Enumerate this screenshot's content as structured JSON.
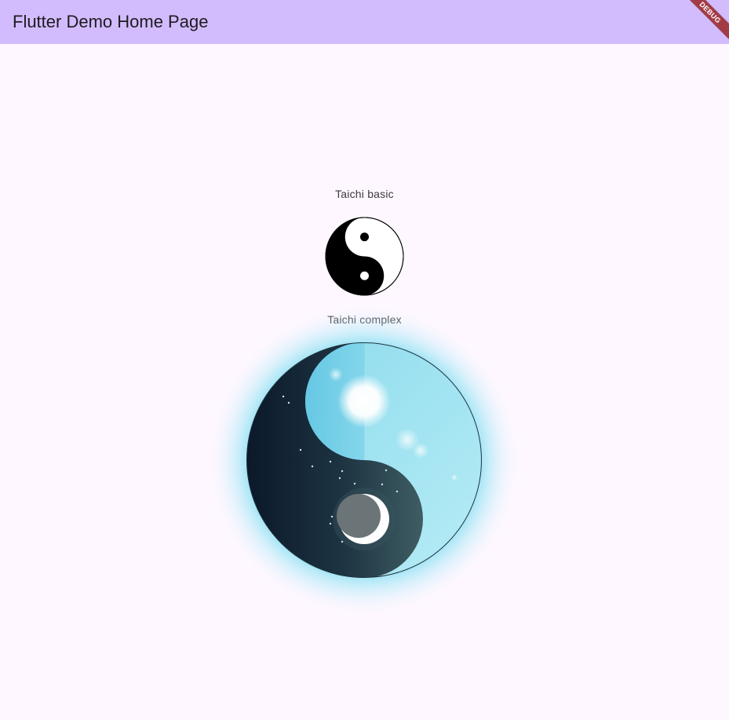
{
  "app_bar": {
    "title": "Flutter Demo Home Page",
    "background_color": "#d2bcfd",
    "debug_label": "DEBUG",
    "debug_color": "#a23b45"
  },
  "page": {
    "background_color": "#fef7ff"
  },
  "sections": [
    {
      "caption": "Taichi basic",
      "style": "black-and-white"
    },
    {
      "caption": "Taichi complex",
      "style": "day-night"
    }
  ],
  "colors": {
    "yin": "#000000",
    "yang": "#ffffff",
    "night_dark": "#0d1a2b",
    "night_light": "#3b5a62",
    "day_light": "#b4eaf6",
    "day_mid": "#5fc6e3",
    "glow": "#6ed8f0",
    "moon": "#6b7477"
  }
}
